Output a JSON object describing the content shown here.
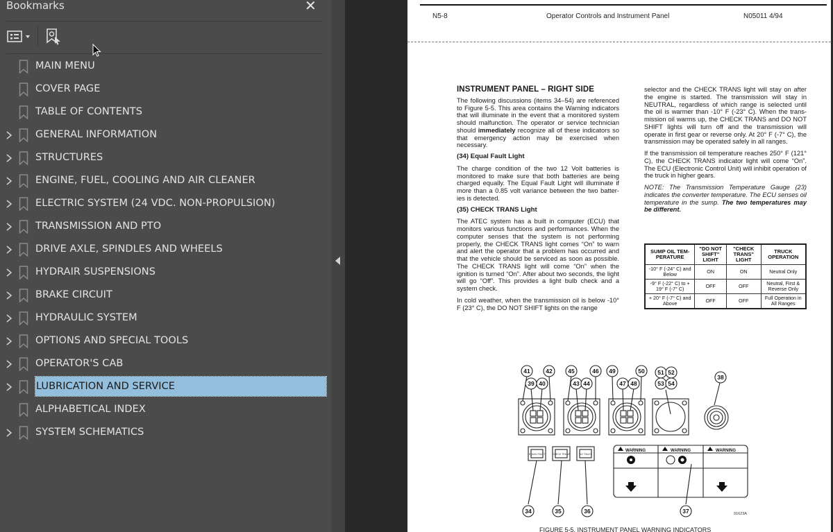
{
  "bookmarks_panel": {
    "title": "Bookmarks",
    "close_icon": "close-icon",
    "toolbar": {
      "options_icon": "list-options-icon",
      "find_bookmark_icon": "find-current-bookmark-icon"
    },
    "items": [
      {
        "label": "MAIN MENU",
        "expandable": false,
        "selected": false
      },
      {
        "label": "COVER PAGE",
        "expandable": false,
        "selected": false
      },
      {
        "label": "TABLE OF CONTENTS",
        "expandable": false,
        "selected": false
      },
      {
        "label": "GENERAL INFORMATION",
        "expandable": true,
        "selected": false
      },
      {
        "label": "STRUCTURES",
        "expandable": true,
        "selected": false
      },
      {
        "label": "ENGINE, FUEL, COOLING AND AIR CLEANER",
        "expandable": true,
        "selected": false
      },
      {
        "label": "ELECTRIC SYSTEM (24 VDC. NON-PROPULSION)",
        "expandable": true,
        "selected": false
      },
      {
        "label": "TRANSMISSION AND PTO",
        "expandable": true,
        "selected": false
      },
      {
        "label": "DRIVE AXLE, SPINDLES AND WHEELS",
        "expandable": true,
        "selected": false
      },
      {
        "label": "HYDRAIR SUSPENSIONS",
        "expandable": true,
        "selected": false
      },
      {
        "label": "BRAKE CIRCUIT",
        "expandable": true,
        "selected": false
      },
      {
        "label": "HYDRAULIC SYSTEM",
        "expandable": true,
        "selected": false
      },
      {
        "label": "OPTIONS AND SPECIAL TOOLS",
        "expandable": true,
        "selected": false
      },
      {
        "label": "OPERATOR'S CAB",
        "expandable": true,
        "selected": false
      },
      {
        "label": "LUBRICATION AND SERVICE",
        "expandable": true,
        "selected": true
      },
      {
        "label": "ALPHABETICAL INDEX",
        "expandable": false,
        "selected": false
      },
      {
        "label": "SYSTEM SCHEMATICS",
        "expandable": true,
        "selected": false
      }
    ],
    "selection_color": "#93bfdc"
  },
  "document": {
    "header": {
      "left": "N5-8",
      "center": "Operator Controls and Instrument Panel",
      "right": "N05011 4/94"
    },
    "left_column": {
      "heading": "INSTRUMENT PANEL – RIGHT SIDE",
      "intro_a": "The following discussions (items 34–54) are referenced to Figure 5-5. This area contains the Warning indicators that will illuminate in the event that a monitored system should malfunction. The operator or service technician should ",
      "intro_bold": "immediately",
      "intro_b": " recognize all of these indicators so that emergency action may be exercised when necessary.",
      "sub1": "(34) Equal Fault Light",
      "sub1_text": "The charge condition of the two 12 Volt batteries is monitored to make sure that both batteries are being charged equally. The Equal Fault Light will illuminate if more than a 0.85 volt variance between the two batter- ies is detected.",
      "sub2": "(35) CHECK TRANS Light",
      "sub2_text": "The ATEC system has a built in computer (ECU) that monitors various functions and performances. When the computer senses that the system is not performing properly, the CHECK TRANS light comes “On” to warn and alert the operator that a problem has occurred and that the vehicle should be serviced as soon as possible. The CHECK TRANS light will come “On” when the ignition is turned “On”. After about two seconds, the light will go “Off”. This provides a light bulb check and a system check.",
      "cold_text": "In cold weather, when the transmission oil is below -10° F (23° C), the DO NOT SHIFT lights on the range"
    },
    "right_column": {
      "cont_text": "selector and the CHECK TRANS light will stay on after the engine is started. The transmission will stay in NEUTRAL, regardless of which range is selected until the oil is warmer than -10° F (-23° C). When the trans- mission oil warms up, the CHECK TRANS and DO NOT SHIFT lights will turn off and the transmission will operate in first gear or reverse only. At 20° F (-7° C), the transmission may be operated safely in all ranges.",
      "temp_text": "If the transmission oil temperature reaches 250° F (121° C), the CHECK TRANS indicator light will come “On”. The ECU (Electronic Control Unit) will inhibit operation of the truck in higher gears.",
      "note_a": "NOTE: The Transmission Temperature Gauge (23) indicates the converter temperature. The ECU senses oil temperature in the sump. ",
      "note_bold": "The two temperatures may be different."
    },
    "oil_table": {
      "headers": [
        "SUMP OIL TEM- PERATURE",
        "\"DO NOT SHIFT\" LIGHT",
        "\"CHECK TRANS\" LIGHT",
        "TRUCK OPERATION"
      ],
      "rows": [
        [
          "-10° F (-24° C) and Below",
          "ON",
          "ON",
          "Neutral Only"
        ],
        [
          "-9° F (-22° C) to + 19° F (-7° C)",
          "OFF",
          "OFF",
          "Neutral, First & Reverse Only"
        ],
        [
          "+ 20° F (-7° C) and Above",
          "OFF",
          "OFF",
          "Full Operation in All Ranges"
        ]
      ]
    },
    "figure": {
      "callouts_top": [
        "41",
        "42",
        "39",
        "40",
        "45",
        "46",
        "43",
        "44",
        "49",
        "50",
        "47",
        "48",
        "51",
        "52",
        "53",
        "54",
        "38"
      ],
      "callouts_bottom": [
        "34",
        "35",
        "36",
        "37"
      ],
      "small_lights": [
        "EQUAL FAULT",
        "CHECK TRANS",
        "ALT FAULT"
      ],
      "warning_label": "WARNING",
      "figure_id": "91623A",
      "caption": "FIGURE 5-5. INSTRUMENT PANEL WARNING INDICATORS"
    }
  }
}
